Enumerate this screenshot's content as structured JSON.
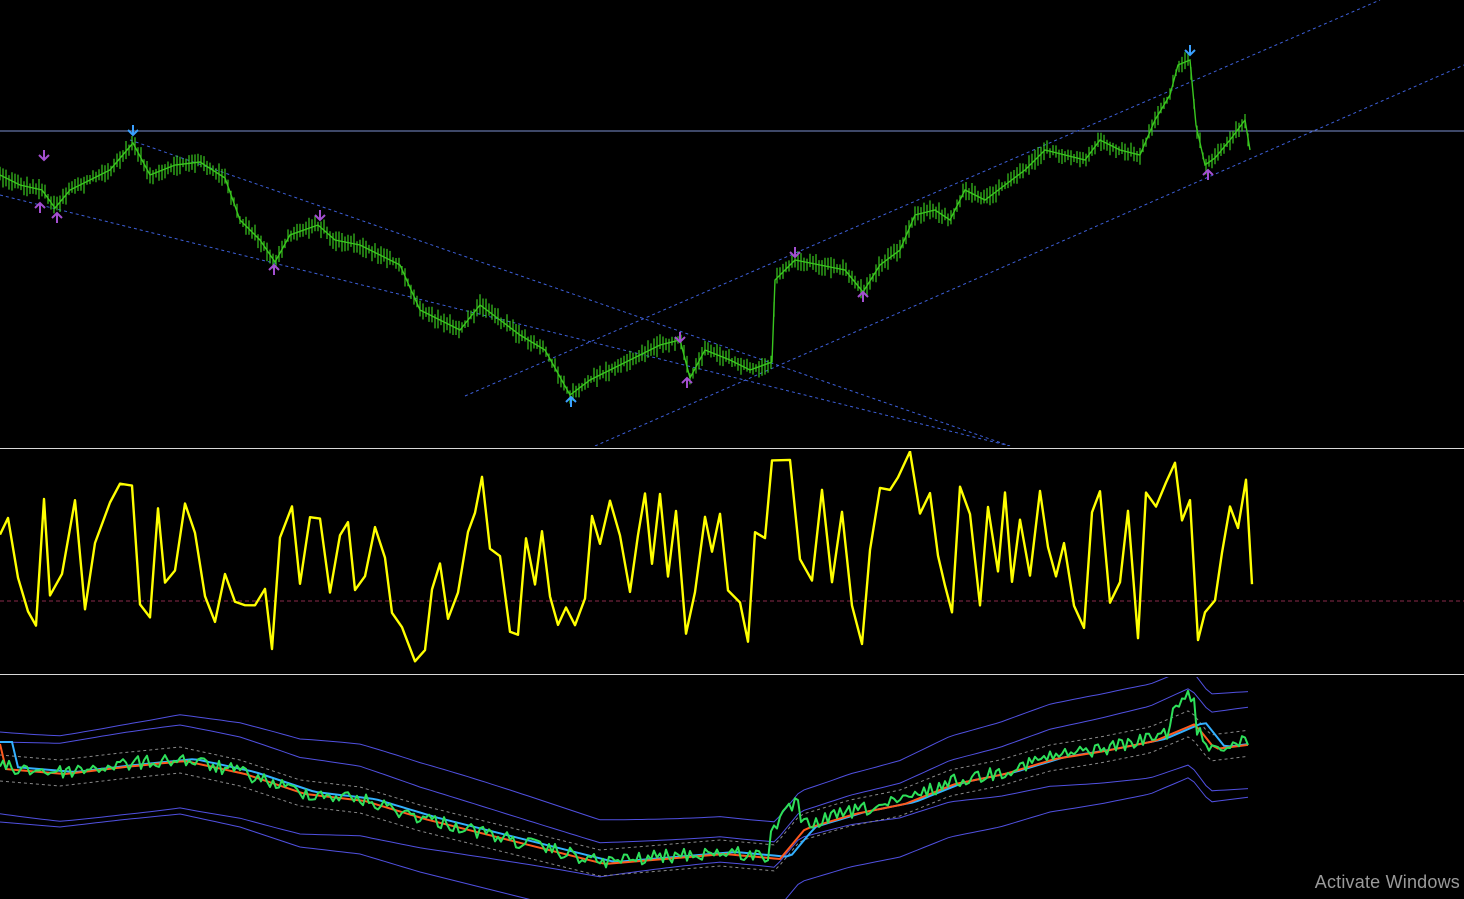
{
  "watermark": {
    "text": "Activate Windows"
  },
  "colors": {
    "background": "#000000",
    "price_bars": "#39c61f",
    "horizontal_level": "#7d8fd0",
    "channel_lines": "#3d5fd8",
    "arrow_fractal": "#a34fd0",
    "arrow_signal": "#3aa0ff",
    "oscillator": "#ffff00",
    "osc_zero_line": "#8a2a4a",
    "band_price": "#2ee05a",
    "band_fast_ma": "#ff5a1e",
    "band_slow_ma": "#33b0ff",
    "band_envelope": "#5050e0",
    "pane_separator": "#d8d8d8"
  },
  "icons": {
    "down_arrow": "arrow-down-icon",
    "up_arrow": "arrow-up-icon"
  }
}
